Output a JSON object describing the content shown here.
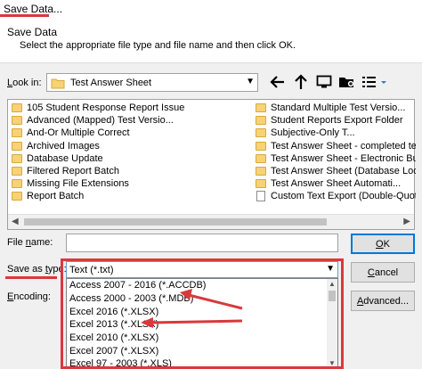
{
  "window": {
    "title": "Save Data..."
  },
  "header": {
    "title": "Save Data",
    "instruction": "Select the appropriate file type and file name and then click OK."
  },
  "lookin": {
    "label_access": "L",
    "label_rest": "ook in:",
    "value": "Test Answer Sheet"
  },
  "toolbar": {
    "back_icon": "back-arrow-icon",
    "up_icon": "up-folder-icon",
    "desktop_icon": "desktop-icon",
    "new_folder_icon": "new-folder-icon",
    "view_icon": "view-menu-icon"
  },
  "files": {
    "left": [
      "105 Student Response Report Issue",
      "Advanced (Mapped) Test Versio...",
      "And-Or Multiple Correct",
      "Archived Images",
      "Database Update",
      "Filtered Report Batch",
      "Missing File Extensions",
      "Report Batch"
    ],
    "right": [
      {
        "name": "Standard Multiple Test Versio...",
        "type": "folder"
      },
      {
        "name": "Student Reports Export Folder",
        "type": "folder"
      },
      {
        "name": "Subjective-Only T...",
        "type": "folder"
      },
      {
        "name": "Test Answer Sheet - completed te...",
        "type": "folder"
      },
      {
        "name": "Test Answer Sheet - Electronic Bubble...",
        "type": "folder"
      },
      {
        "name": "Test Answer Sheet (Database Looku...",
        "type": "folder"
      },
      {
        "name": "Test Answer Sheet Automati...",
        "type": "folder"
      },
      {
        "name": "Custom Text Export (Double-Quote Te...",
        "type": "file"
      }
    ]
  },
  "filename": {
    "label_pre": "File ",
    "label_access": "n",
    "label_post": "ame:",
    "value": ""
  },
  "saveastype": {
    "label_pre": "Save as ",
    "label_access": "t",
    "label_post": "ype:",
    "selected": "Text (*.txt)",
    "options": [
      "Access 2007 - 2016 (*.ACCDB)",
      "Access 2000 - 2003 (*.MDB)",
      "Excel 2016 (*.XLSX)",
      "Excel 2013 (*.XLSX)",
      "Excel 2010 (*.XLSX)",
      "Excel 2007 (*.XLSX)",
      "Excel 97 - 2003 (*.XLS)"
    ]
  },
  "encoding": {
    "label_access": "E",
    "label_rest": "ncoding:"
  },
  "buttons": {
    "ok_access": "O",
    "ok_rest": "K",
    "cancel_access": "C",
    "cancel_rest": "ancel",
    "advanced_access": "A",
    "advanced_rest": "dvanced..."
  },
  "colors": {
    "highlight_red": "#d9393d",
    "folder_yellow": "#f7d276",
    "focus_blue": "#0078d7"
  }
}
